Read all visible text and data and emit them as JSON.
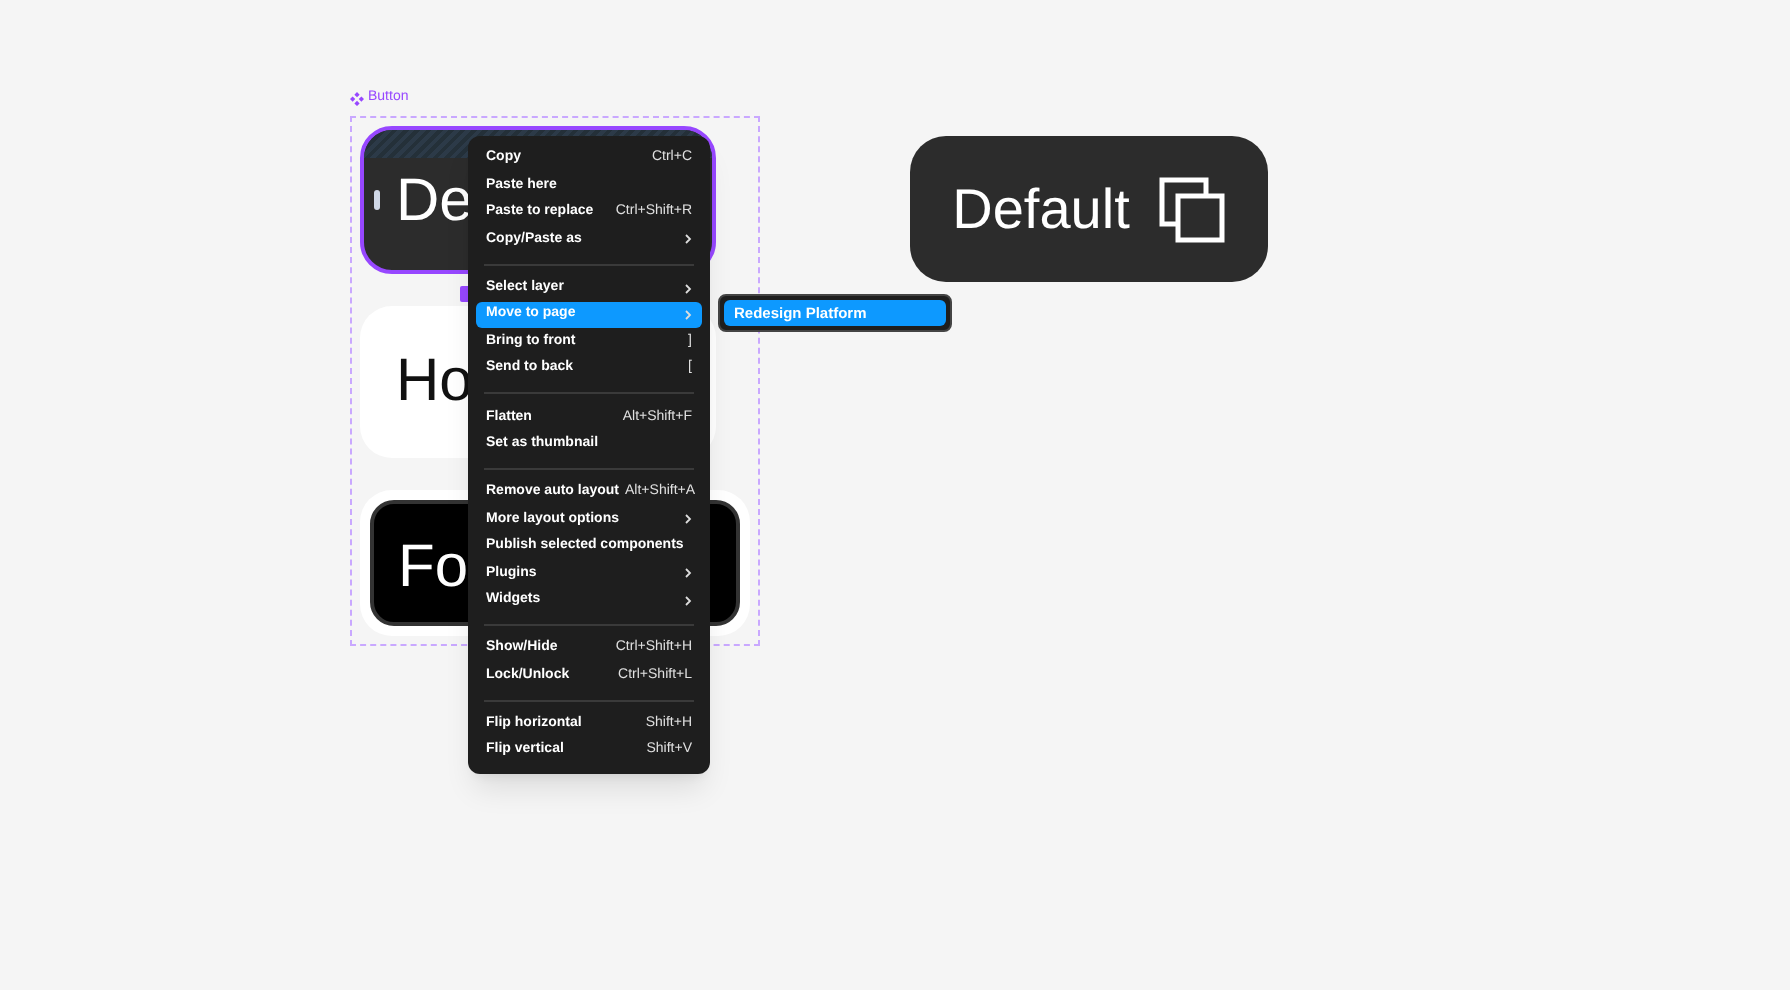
{
  "frame_label": "Button",
  "variants": [
    {
      "kind": "default",
      "text": "De"
    },
    {
      "kind": "hover",
      "text": "Ho"
    },
    {
      "kind": "focus",
      "text": "Fo"
    }
  ],
  "context_menu": [
    [
      {
        "label": "Copy",
        "shortcut": "Ctrl+C",
        "submenu": false,
        "selected": false
      },
      {
        "label": "Paste here",
        "submenu": false,
        "selected": false
      },
      {
        "label": "Paste to replace",
        "shortcut": "Ctrl+Shift+R",
        "submenu": false,
        "selected": false
      },
      {
        "label": "Copy/Paste as",
        "submenu": true,
        "selected": false
      }
    ],
    [
      {
        "label": "Select layer",
        "submenu": true,
        "selected": false
      },
      {
        "label": "Move to page",
        "submenu": true,
        "selected": true
      },
      {
        "label": "Bring to front",
        "shortcut": "]",
        "submenu": false,
        "selected": false
      },
      {
        "label": "Send to back",
        "shortcut": "[",
        "submenu": false,
        "selected": false
      }
    ],
    [
      {
        "label": "Flatten",
        "shortcut": "Alt+Shift+F",
        "submenu": false,
        "selected": false
      },
      {
        "label": "Set as thumbnail",
        "submenu": false,
        "selected": false
      }
    ],
    [
      {
        "label": "Remove auto layout",
        "shortcut": "Alt+Shift+A",
        "submenu": false,
        "selected": false
      },
      {
        "label": "More layout options",
        "submenu": true,
        "selected": false
      },
      {
        "label": "Publish selected components",
        "submenu": false,
        "selected": false
      },
      {
        "label": "Plugins",
        "submenu": true,
        "selected": false
      },
      {
        "label": "Widgets",
        "submenu": true,
        "selected": false
      }
    ],
    [
      {
        "label": "Show/Hide",
        "shortcut": "Ctrl+Shift+H",
        "submenu": false,
        "selected": false
      },
      {
        "label": "Lock/Unlock",
        "shortcut": "Ctrl+Shift+L",
        "submenu": false,
        "selected": false
      }
    ],
    [
      {
        "label": "Flip horizontal",
        "shortcut": "Shift+H",
        "submenu": false,
        "selected": false
      },
      {
        "label": "Flip vertical",
        "shortcut": "Shift+V",
        "submenu": false,
        "selected": false
      }
    ]
  ],
  "submenu": [
    {
      "label": "Redesign Platform",
      "selected": true
    }
  ],
  "preview_button": {
    "text": "Default"
  }
}
